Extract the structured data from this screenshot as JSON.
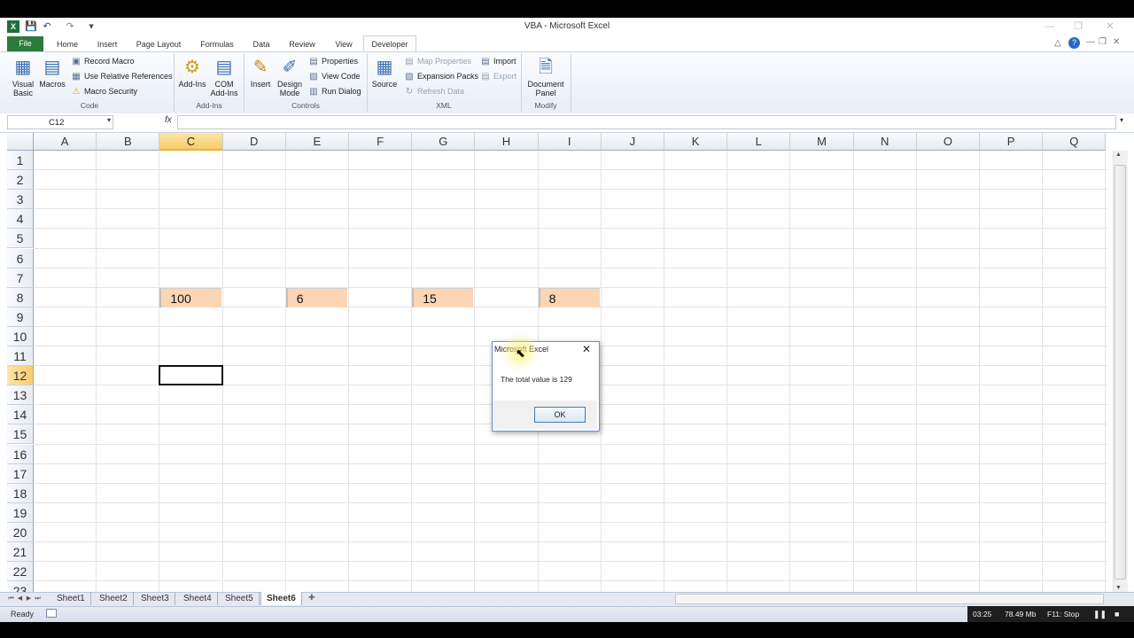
{
  "window": {
    "title": "VBA  -  Microsoft Excel",
    "min_label": "—",
    "max_label": "❐",
    "close_label": "✕"
  },
  "qat": {
    "save": "💾",
    "undo": "↶",
    "redo": "↷",
    "customize": "▾"
  },
  "tabs": [
    "File",
    "Home",
    "Insert",
    "Page Layout",
    "Formulas",
    "Data",
    "Review",
    "View",
    "Developer"
  ],
  "ribbon": {
    "groups": [
      "Code",
      "Add-Ins",
      "Controls",
      "XML",
      "Modify"
    ],
    "visual_basic": "Visual\nBasic",
    "macros": "Macros",
    "record_macro": "Record Macro",
    "use_relative": "Use Relative References",
    "macro_security": "Macro Security",
    "add_ins": "Add-Ins",
    "com_add_ins": "COM\nAdd-Ins",
    "insert": "Insert",
    "design_mode": "Design\nMode",
    "properties": "Properties",
    "view_code": "View Code",
    "run_dialog": "Run Dialog",
    "source": "Source",
    "map_properties": "Map Properties",
    "expansion_packs": "Expansion Packs",
    "refresh_data": "Refresh Data",
    "import": "Import",
    "export": "Export",
    "document_panel": "Document\nPanel"
  },
  "formula_bar": {
    "name_box": "C12",
    "fx": "fx",
    "value": ""
  },
  "sheet": {
    "columns": [
      "A",
      "B",
      "C",
      "D",
      "E",
      "F",
      "G",
      "H",
      "I",
      "J",
      "K",
      "L",
      "M",
      "N",
      "O",
      "P",
      "Q"
    ],
    "rows": [
      "1",
      "2",
      "3",
      "4",
      "5",
      "6",
      "7",
      "8",
      "9",
      "10",
      "11",
      "12",
      "13",
      "14",
      "15",
      "16",
      "17",
      "18",
      "19",
      "20",
      "21",
      "22",
      "23"
    ],
    "selected_column": "C",
    "selected_row": "12",
    "active_cell": "C12",
    "cells": [
      {
        "ref": "C8",
        "value": "100"
      },
      {
        "ref": "E8",
        "value": "6"
      },
      {
        "ref": "G8",
        "value": "15"
      },
      {
        "ref": "I8",
        "value": "8"
      }
    ]
  },
  "sheet_tabs": [
    "Sheet1",
    "Sheet2",
    "Sheet3",
    "Sheet4",
    "Sheet5",
    "Sheet6"
  ],
  "active_sheet": "Sheet6",
  "status": {
    "ready": "Ready"
  },
  "recorder": {
    "time": "03:25",
    "size": "78.49 Mb",
    "stop": "F11: Stop"
  },
  "dialog": {
    "title": "Microsoft Excel",
    "message": "The total value is 129",
    "ok": "OK"
  },
  "colors": {
    "cell_fill": "#fcd5b4",
    "file_tab": "#2c7a3c",
    "selection": "#f8cd6a"
  }
}
